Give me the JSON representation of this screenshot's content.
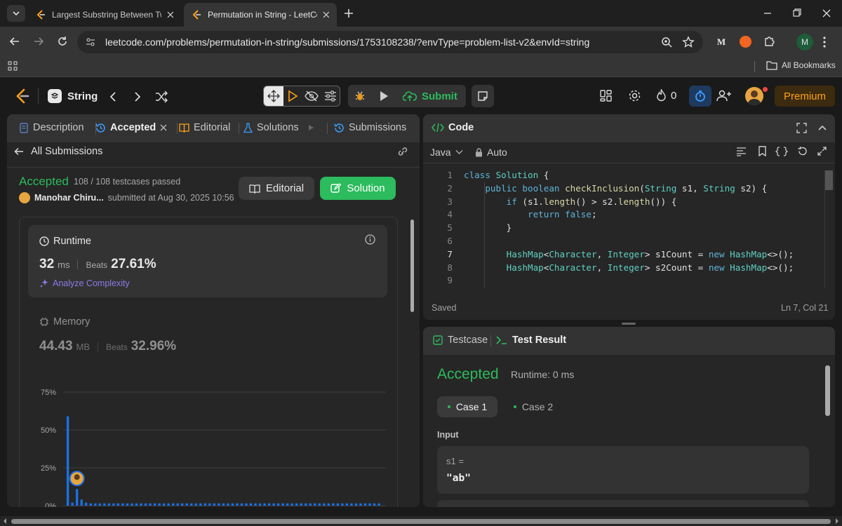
{
  "browser": {
    "tabs": [
      {
        "title": "Largest Substring Between Two",
        "active": false
      },
      {
        "title": "Permutation in String - LeetCod",
        "active": true
      }
    ],
    "url": "leetcode.com/problems/permutation-in-string/submissions/1753108238/?envType=problem-list-v2&envId=string",
    "bookmarks_label": "All Bookmarks",
    "profile_letter": "M",
    "ext_letter": "M"
  },
  "nav": {
    "problem_list": "String",
    "submit_label": "Submit",
    "streak_count": "0",
    "premium_label": "Premium"
  },
  "left": {
    "tabs": {
      "description": "Description",
      "accepted": "Accepted",
      "editorial": "Editorial",
      "solutions": "Solutions",
      "submissions": "Submissions"
    },
    "back_label": "All Submissions",
    "status": "Accepted",
    "testcases": "108 / 108 testcases passed",
    "user_name": "Manohar Chiru...",
    "submitted_at": "submitted at Aug 30, 2025 10:56",
    "editorial_btn": "Editorial",
    "solution_btn": "Solution",
    "runtime": {
      "title": "Runtime",
      "value": "32",
      "unit": "ms",
      "beats_label": "Beats",
      "beats": "27.61%",
      "analyze": "Analyze Complexity"
    },
    "memory": {
      "title": "Memory",
      "value": "44.43",
      "unit": "MB",
      "beats_label": "Beats",
      "beats": "32.96%"
    }
  },
  "chart_data": {
    "type": "bar",
    "ylim": [
      0,
      75
    ],
    "yticks": [
      "75%",
      "50%",
      "25%",
      "0%"
    ],
    "values": [
      59,
      2,
      11,
      4,
      2,
      1.5,
      1.5,
      1.5,
      1.5,
      1.5,
      1.5,
      1.5,
      1.5,
      1.5,
      1.5,
      1.5,
      1.5,
      1.5,
      1.5,
      1.5,
      1.5,
      1.5,
      1.5,
      1.5,
      1.5,
      1.5,
      1.5,
      1.5,
      1.5,
      1.5,
      1.5,
      1.5,
      1.5,
      1.5,
      1.5,
      1.5,
      1.5,
      1.5,
      1.5,
      1.5,
      1.5,
      1.5,
      1.5,
      1.5,
      1.5,
      1.5,
      1.5,
      1.5,
      1.5,
      1.5,
      1.5,
      1.5,
      1.5,
      1.5,
      1.5,
      1.5,
      1.5,
      1.5,
      1.5,
      1.5,
      1.5,
      1.5,
      1.5,
      1.5,
      1.5,
      1.5,
      1.5,
      1.5,
      1.5
    ],
    "highlight_index": 2,
    "bar_color": "#1a73e8",
    "grid": true
  },
  "code": {
    "title": "Code",
    "language": "Java",
    "mode": "Auto",
    "saved": "Saved",
    "cursor": "Ln 7, Col 21",
    "lines": [
      [
        {
          "t": "class ",
          "c": "kw"
        },
        {
          "t": "Solution",
          "c": "ty"
        },
        {
          "t": " {",
          "c": "pl"
        }
      ],
      [
        {
          "t": "    public ",
          "c": "kw"
        },
        {
          "t": "boolean ",
          "c": "kw"
        },
        {
          "t": "checkInclusion",
          "c": "fn"
        },
        {
          "t": "(",
          "c": "pl"
        },
        {
          "t": "String",
          "c": "ty"
        },
        {
          "t": " s1, ",
          "c": "pl"
        },
        {
          "t": "String",
          "c": "ty"
        },
        {
          "t": " s2) {",
          "c": "pl"
        }
      ],
      [
        {
          "t": "        if ",
          "c": "kw"
        },
        {
          "t": "(s1.",
          "c": "pl"
        },
        {
          "t": "length",
          "c": "fn"
        },
        {
          "t": "() > s2.",
          "c": "pl"
        },
        {
          "t": "length",
          "c": "fn"
        },
        {
          "t": "()) {",
          "c": "pl"
        }
      ],
      [
        {
          "t": "            return ",
          "c": "kw"
        },
        {
          "t": "false",
          "c": "kw"
        },
        {
          "t": ";",
          "c": "pl"
        }
      ],
      [
        {
          "t": "        }",
          "c": "pl"
        }
      ],
      [
        {
          "t": "",
          "c": "pl"
        }
      ],
      [
        {
          "t": "        HashMap",
          "c": "ty"
        },
        {
          "t": "<",
          "c": "pl"
        },
        {
          "t": "Character",
          "c": "ty"
        },
        {
          "t": ", ",
          "c": "pl"
        },
        {
          "t": "Integer",
          "c": "ty"
        },
        {
          "t": "> s1Count = ",
          "c": "pl"
        },
        {
          "t": "new ",
          "c": "kw"
        },
        {
          "t": "HashMap",
          "c": "ty"
        },
        {
          "t": "<>();",
          "c": "pl"
        }
      ],
      [
        {
          "t": "        HashMap",
          "c": "ty"
        },
        {
          "t": "<",
          "c": "pl"
        },
        {
          "t": "Character",
          "c": "ty"
        },
        {
          "t": ", ",
          "c": "pl"
        },
        {
          "t": "Integer",
          "c": "ty"
        },
        {
          "t": "> s2Count = ",
          "c": "pl"
        },
        {
          "t": "new ",
          "c": "kw"
        },
        {
          "t": "HashMap",
          "c": "ty"
        },
        {
          "t": "<>();",
          "c": "pl"
        }
      ],
      [
        {
          "t": "",
          "c": "pl"
        }
      ]
    ],
    "line_numbers": [
      "1",
      "2",
      "3",
      "4",
      "5",
      "6",
      "7",
      "8",
      "9"
    ]
  },
  "testresult": {
    "tab_testcase": "Testcase",
    "tab_result": "Test Result",
    "status": "Accepted",
    "runtime": "Runtime: 0 ms",
    "case1": "Case 1",
    "case2": "Case 2",
    "input_label": "Input",
    "var_label": "s1 =",
    "var_value": "\"ab\""
  },
  "colors": {
    "accent_green": "#2cbb5d",
    "premium_bg": "#3d2b0f",
    "premium_text": "#ffa116"
  }
}
